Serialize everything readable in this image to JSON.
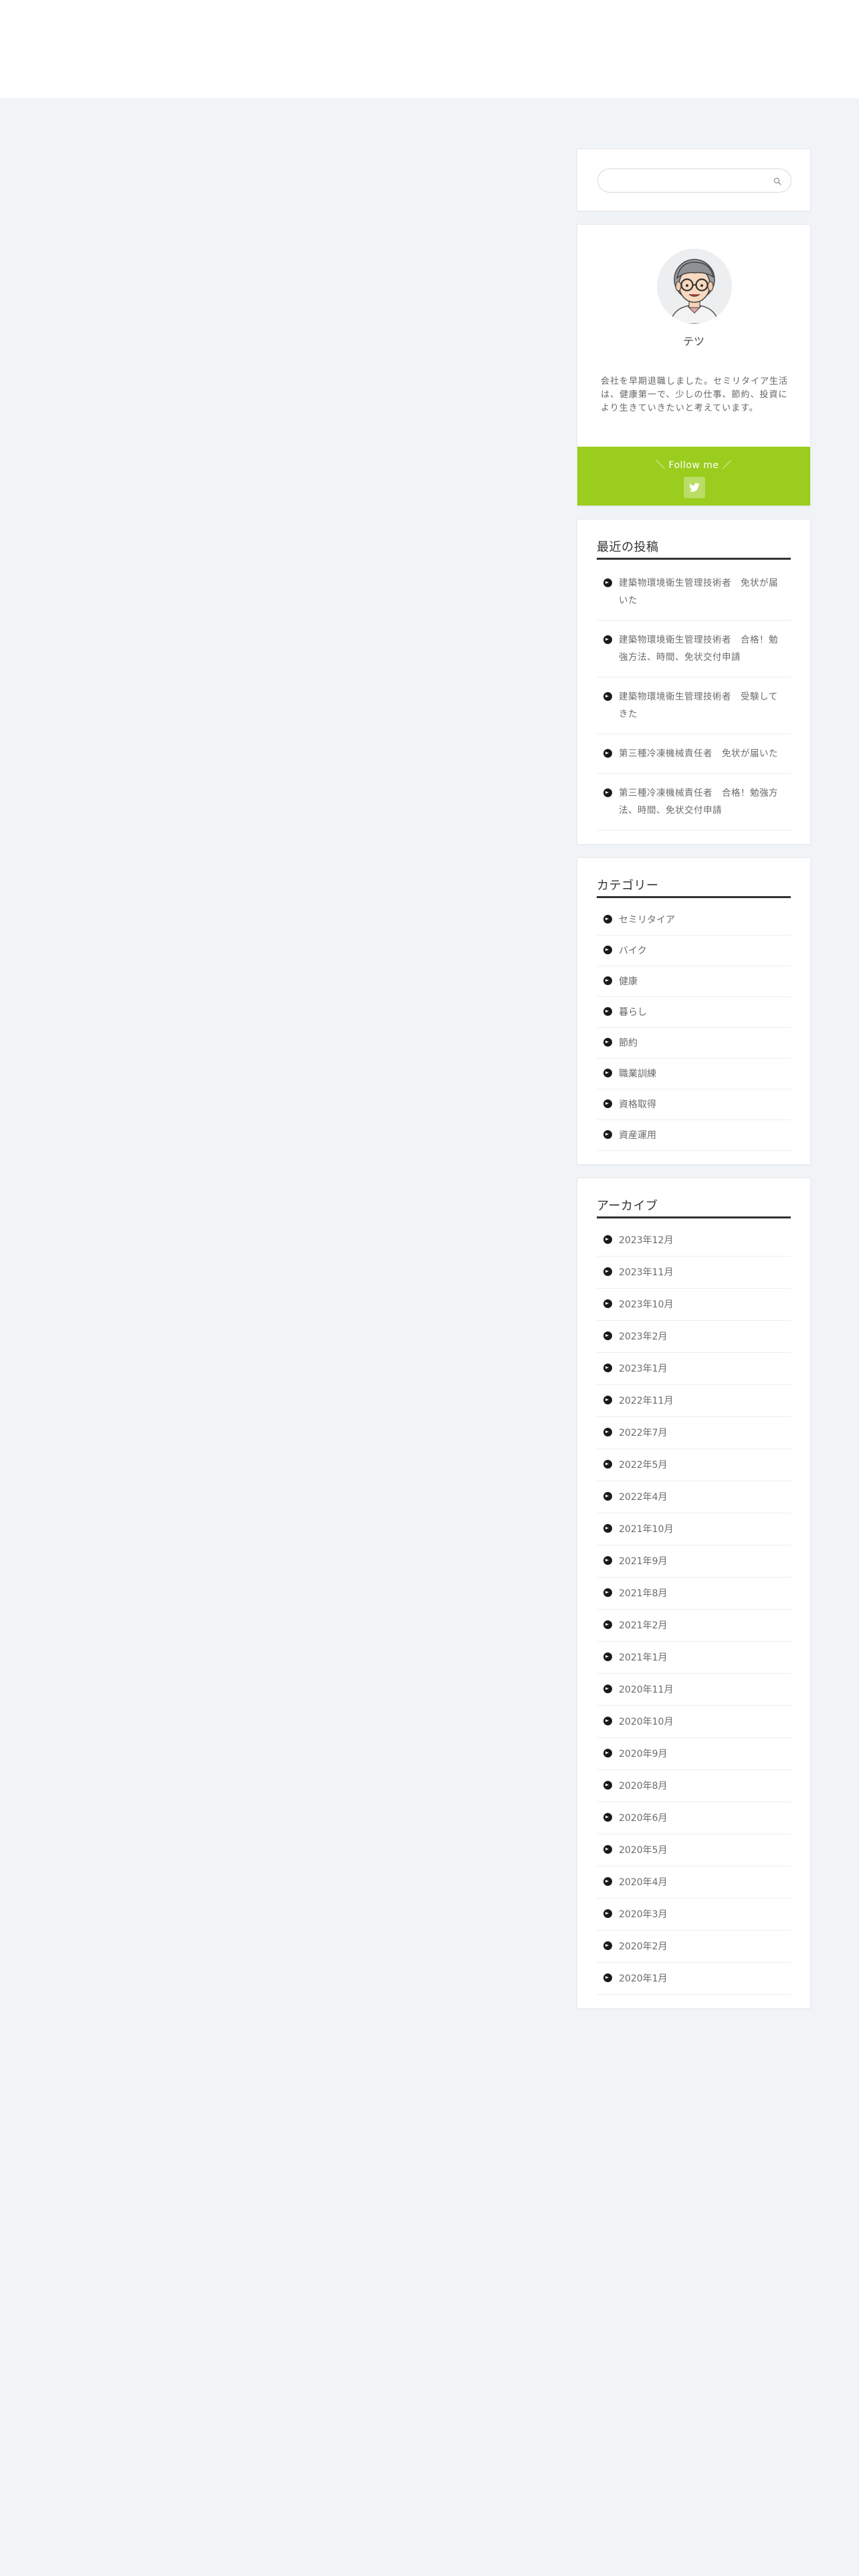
{
  "search": {
    "placeholder": ""
  },
  "profile": {
    "name": "テツ",
    "description": "会社を早期退職しました。セミリタイア生活は、健康第一で、少しの仕事、節約、投資により生きていきたいと考えています。",
    "follow_label": "＼ Follow me ／",
    "social_icon": "twitter-icon",
    "accent_color": "#9acd1e"
  },
  "recent_posts": {
    "title": "最近の投稿",
    "items": [
      "建築物環境衛生管理技術者　免状が届いた",
      "建築物環境衛生管理技術者　合格！勉強方法、時間、免状交付申請",
      "建築物環境衛生管理技術者　受験してきた",
      "第三種冷凍機械責任者　免状が届いた",
      "第三種冷凍機械責任者　合格！勉強方法、時間、免状交付申請"
    ]
  },
  "categories": {
    "title": "カテゴリー",
    "items": [
      "セミリタイア",
      "バイク",
      "健康",
      "暮らし",
      "節約",
      "職業訓練",
      "資格取得",
      "資産運用"
    ]
  },
  "archives": {
    "title": "アーカイブ",
    "items": [
      "2023年12月",
      "2023年11月",
      "2023年10月",
      "2023年2月",
      "2023年1月",
      "2022年11月",
      "2022年7月",
      "2022年5月",
      "2022年4月",
      "2021年10月",
      "2021年9月",
      "2021年8月",
      "2021年2月",
      "2021年1月",
      "2020年11月",
      "2020年10月",
      "2020年9月",
      "2020年8月",
      "2020年6月",
      "2020年5月",
      "2020年4月",
      "2020年3月",
      "2020年2月",
      "2020年1月"
    ]
  }
}
